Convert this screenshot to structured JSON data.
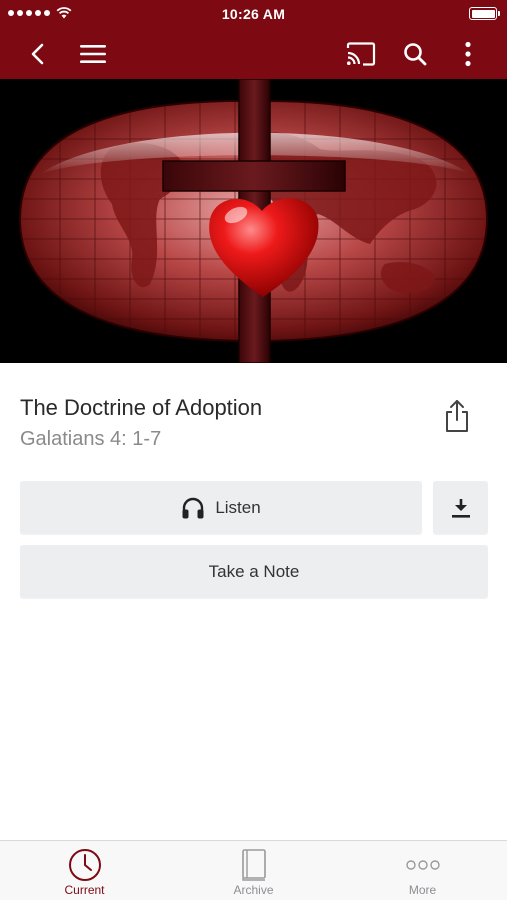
{
  "status_bar": {
    "time": "10:26 AM"
  },
  "colors": {
    "brand": "#7d0a12",
    "button_bg": "#eceef0",
    "tab_inactive": "#8e8e93"
  },
  "nav": {
    "icons": [
      "back-icon",
      "menu-icon",
      "cast-icon",
      "search-icon",
      "more-vertical-icon"
    ]
  },
  "sermon": {
    "title": "The Doctrine of Adoption",
    "scripture": "Galatians 4: 1-7"
  },
  "actions": {
    "listen_label": "Listen",
    "note_label": "Take a Note"
  },
  "tabs": [
    {
      "label": "Current",
      "icon": "clock-icon",
      "active": true
    },
    {
      "label": "Archive",
      "icon": "book-icon",
      "active": false
    },
    {
      "label": "More",
      "icon": "ellipsis-icon",
      "active": false
    }
  ]
}
